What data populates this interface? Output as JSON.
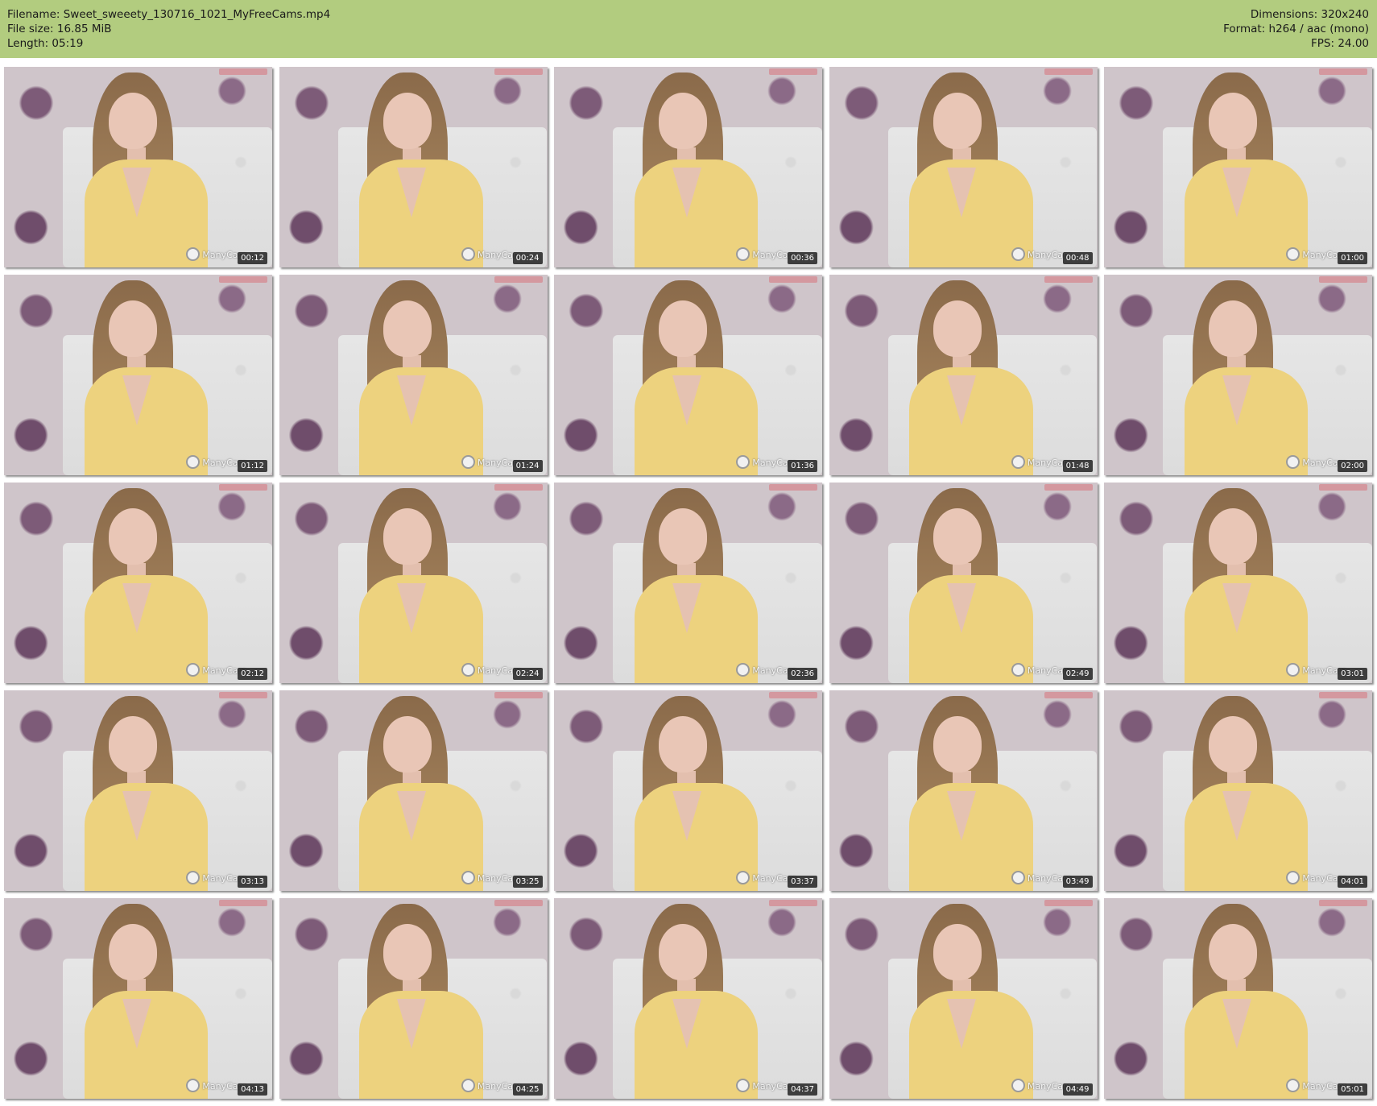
{
  "header": {
    "filename_label": "Filename: Sweet_sweeety_130716_1021_MyFreeCams.mp4",
    "filesize_label": "File size: 16.85 MiB",
    "length_label": "Length: 05:19",
    "dimensions_label": "Dimensions: 320x240",
    "format_label": "Format: h264 / aac (mono)",
    "fps_label": "FPS: 24.00"
  },
  "thumbnails": [
    {
      "time": "00:12",
      "logo_text": "ManyCam"
    },
    {
      "time": "00:24",
      "logo_text": "ManyCam"
    },
    {
      "time": "00:36",
      "logo_text": "ManyCam"
    },
    {
      "time": "00:48",
      "logo_text": "ManyCam"
    },
    {
      "time": "01:00",
      "logo_text": "ManyCam"
    },
    {
      "time": "01:12",
      "logo_text": "ManyCam"
    },
    {
      "time": "01:24",
      "logo_text": "ManyCam"
    },
    {
      "time": "01:36",
      "logo_text": "ManyCam"
    },
    {
      "time": "01:48",
      "logo_text": "ManyCam"
    },
    {
      "time": "02:00",
      "logo_text": "ManyCam"
    },
    {
      "time": "02:12",
      "logo_text": "ManyCam"
    },
    {
      "time": "02:24",
      "logo_text": "ManyCam"
    },
    {
      "time": "02:36",
      "logo_text": "ManyCam"
    },
    {
      "time": "02:49",
      "logo_text": "ManyCam"
    },
    {
      "time": "03:01",
      "logo_text": "ManyCam"
    },
    {
      "time": "03:13",
      "logo_text": "ManyCam"
    },
    {
      "time": "03:25",
      "logo_text": "ManyCam"
    },
    {
      "time": "03:37",
      "logo_text": "ManyCam"
    },
    {
      "time": "03:49",
      "logo_text": "ManyCam"
    },
    {
      "time": "04:01",
      "logo_text": "ManyCam"
    },
    {
      "time": "04:13",
      "logo_text": "ManyCam"
    },
    {
      "time": "04:25",
      "logo_text": "ManyCam"
    },
    {
      "time": "04:37",
      "logo_text": "ManyCam"
    },
    {
      "time": "04:49",
      "logo_text": "ManyCam"
    },
    {
      "time": "05:01",
      "logo_text": "ManyCam"
    }
  ]
}
